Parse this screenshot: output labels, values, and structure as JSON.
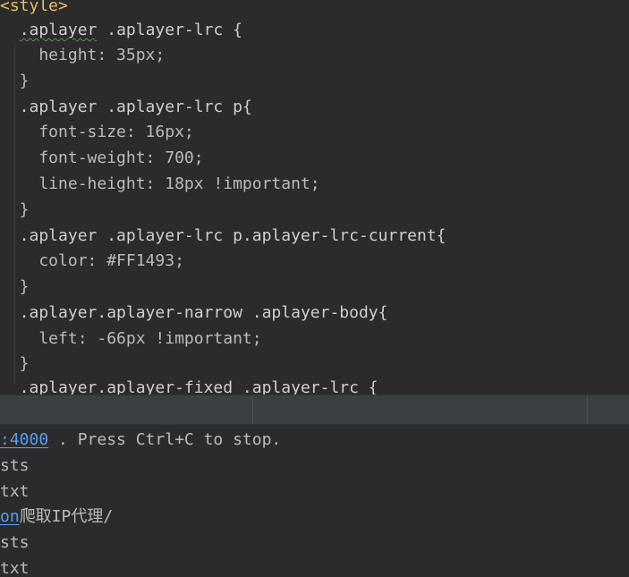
{
  "editor": {
    "lines": [
      {
        "parts": [
          {
            "t": "<style>",
            "c": "tag"
          }
        ]
      },
      {
        "parts": [
          {
            "t": "  ",
            "c": "ws"
          },
          {
            "t": ".aplayer",
            "c": "sel-sq"
          },
          {
            "t": " ",
            "c": "ws"
          },
          {
            "t": ".aplayer-lrc {",
            "c": "sel-sq2"
          }
        ]
      },
      {
        "parts": [
          {
            "t": "    height: 35px;",
            "c": "prop"
          }
        ]
      },
      {
        "parts": [
          {
            "t": "  }",
            "c": "prop"
          }
        ]
      },
      {
        "parts": [
          {
            "t": "  .aplayer .aplayer-lrc p{",
            "c": "sel"
          }
        ]
      },
      {
        "parts": [
          {
            "t": "    font-size: 16px;",
            "c": "prop"
          }
        ]
      },
      {
        "parts": [
          {
            "t": "    font-weight: 700;",
            "c": "prop"
          }
        ]
      },
      {
        "parts": [
          {
            "t": "    line-height: 18px !important;",
            "c": "prop"
          }
        ]
      },
      {
        "parts": [
          {
            "t": "  }",
            "c": "prop"
          }
        ]
      },
      {
        "parts": [
          {
            "t": "  .aplayer .aplayer-lrc p.aplayer-lrc-current{",
            "c": "sel"
          }
        ]
      },
      {
        "parts": [
          {
            "t": "    color: #FF1493;",
            "c": "prop"
          }
        ]
      },
      {
        "parts": [
          {
            "t": "  }",
            "c": "prop"
          }
        ]
      },
      {
        "parts": [
          {
            "t": "  .aplayer.aplayer-narrow .aplayer-body{",
            "c": "sel"
          }
        ]
      },
      {
        "parts": [
          {
            "t": "    left: -66px !important;",
            "c": "prop"
          }
        ]
      },
      {
        "parts": [
          {
            "t": "  }",
            "c": "prop"
          }
        ]
      }
    ],
    "cut_line": "  .aplayer.aplayer-fixed .aplayer-lrc {"
  },
  "terminal": {
    "line1_link": ":4000",
    "line1_text": " . Press Ctrl+C to stop.",
    "line2": "sts",
    "line3": "txt",
    "line4_link": "on",
    "line4_text": "爬取IP代理/",
    "line5": "sts",
    "line6": "txt"
  }
}
